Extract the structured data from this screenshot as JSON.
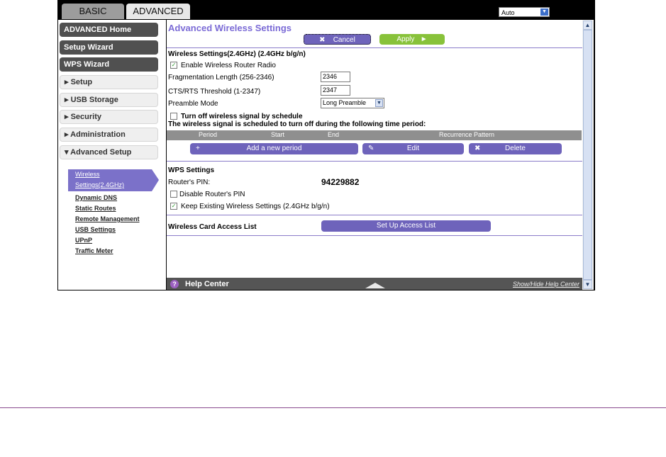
{
  "tabs": {
    "basic": "BASIC",
    "advanced": "ADVANCED"
  },
  "language_select": {
    "value": "Auto"
  },
  "sidebar": {
    "advanced_home": "ADVANCED Home",
    "setup_wizard": "Setup Wizard",
    "wps_wizard": "WPS Wizard",
    "setup": "Setup",
    "usb_storage": "USB Storage",
    "security": "Security",
    "administration": "Administration",
    "advanced_setup": "Advanced Setup",
    "sub_active_line1": "Wireless",
    "sub_active_line2": "Settings(2.4GHz)",
    "dynamic_dns": "Dynamic DNS",
    "static_routes": "Static Routes",
    "remote_management": "Remote Management",
    "usb_settings": "USB Settings",
    "upnp": "UPnP",
    "traffic_meter": "Traffic Meter"
  },
  "main": {
    "title": "Advanced Wireless Settings",
    "cancel": "Cancel",
    "apply": "Apply",
    "section_wireless": "Wireless Settings(2.4GHz) (2.4GHz b/g/n)",
    "enable_radio": "Enable Wireless Router Radio",
    "frag_label": "Fragmentation Length (256-2346)",
    "frag_value": "2346",
    "cts_label": "CTS/RTS Threshold (1-2347)",
    "cts_value": "2347",
    "preamble_label": "Preamble Mode",
    "preamble_value": "Long Preamble",
    "schedule_label": "Turn off wireless signal by schedule",
    "schedule_note": "The wireless signal is scheduled to turn off during the following time period:",
    "col_period": "Period",
    "col_start": "Start",
    "col_end": "End",
    "col_recurrence": "Recurrence Pattern",
    "add_period": "Add a new period",
    "edit": "Edit",
    "delete": "Delete",
    "wps_section": "WPS Settings",
    "router_pin_label": "Router's PIN:",
    "router_pin_value": "94229882",
    "disable_pin": "Disable Router's PIN",
    "keep_existing": "Keep Existing Wireless Settings (2.4GHz b/g/n)",
    "card_access_label": "Wireless Card Access List",
    "setup_access_list": "Set Up Access List",
    "help_center": "Help Center",
    "show_hide_help": "Show/Hide Help Center"
  }
}
